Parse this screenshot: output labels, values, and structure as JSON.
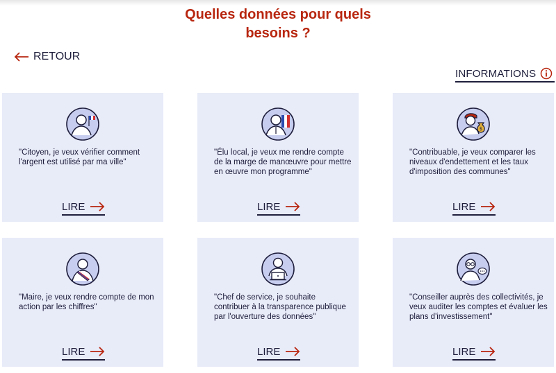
{
  "header": {
    "title_line1": "Quelles données pour quels",
    "title_line2": "besoins ?"
  },
  "nav": {
    "back_label": "RETOUR",
    "info_label": "INFORMATIONS"
  },
  "colors": {
    "accent": "#b8260f",
    "text": "#1e1e3c",
    "card_bg": "#e8ebf8"
  },
  "cards": [
    {
      "icon": "citizen-flag-icon",
      "quote": "\"Citoyen, je veux vérifier comment l'argent est utilisé par ma ville\"",
      "button": "LIRE"
    },
    {
      "icon": "elected-official-flag-icon",
      "quote": "\"Élu local, je veux me rendre compte de la marge de manœuvre pour mettre en œuvre mon programme\"",
      "button": "LIRE"
    },
    {
      "icon": "taxpayer-money-bag-icon",
      "quote": "\"Contribuable, je veux comparer les niveaux d'endettement et les taux d'imposition des communes\"",
      "button": "LIRE"
    },
    {
      "icon": "mayor-sash-icon",
      "quote": "\"Maire, je veux rendre compte de mon action par les chiffres\"",
      "button": "LIRE"
    },
    {
      "icon": "department-head-laptop-icon",
      "quote": "\"Chef de service, je souhaite contribuer à la transparence publique par l'ouverture des données\"",
      "button": "LIRE"
    },
    {
      "icon": "advisor-glasses-speech-icon",
      "quote": "\"Conseiller auprès des collectivités, je veux auditer les comptes et évaluer les plans d'investissement\"",
      "button": "LIRE"
    }
  ]
}
